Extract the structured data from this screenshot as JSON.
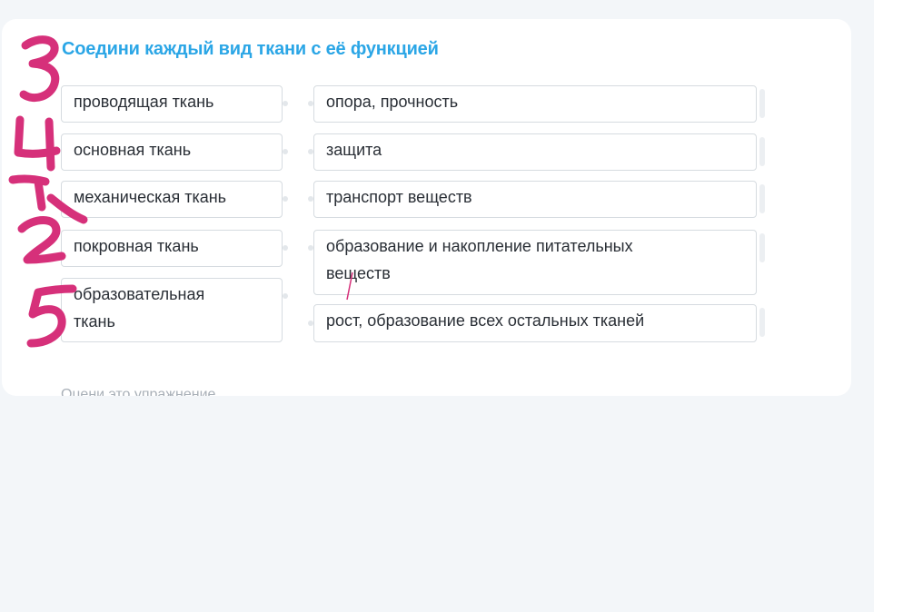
{
  "exercise": {
    "title": "Соедини каждый вид ткани с её функцией",
    "left_items": [
      {
        "label": "проводящая ткань"
      },
      {
        "label": "основная ткань"
      },
      {
        "label": "механическая ткань"
      },
      {
        "label": "покровная ткань"
      },
      {
        "label": "образовательная ткань"
      }
    ],
    "right_items": [
      {
        "label": "опора, прочность"
      },
      {
        "label": "защита"
      },
      {
        "label": "транспорт веществ"
      },
      {
        "label": "образование и накопление питательных веществ"
      },
      {
        "label": "рост, образование всех остальных тканей"
      }
    ],
    "footer_label": "Оцени это упражнение"
  },
  "annotations": {
    "handwritten_numbers": [
      "3",
      "4",
      "1",
      "2",
      "5"
    ],
    "ink_color": "#d6307a"
  },
  "colors": {
    "accent": "#2ba6e6",
    "background": "#f3f6f9",
    "card": "#ffffff",
    "border": "#d6dbe0"
  }
}
